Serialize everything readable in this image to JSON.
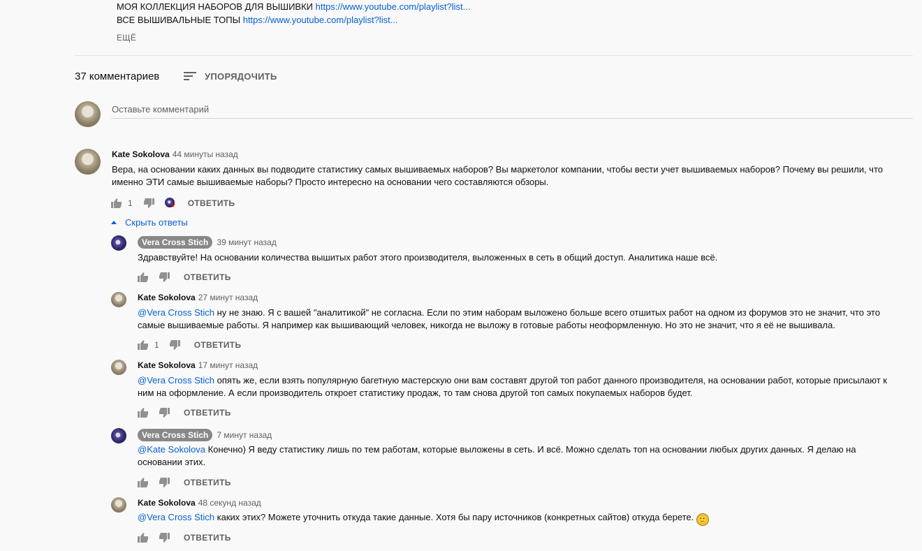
{
  "description": {
    "line1_text": "МОЯ КОЛЛЕКЦИЯ НАБОРОВ ДЛЯ ВЫШИВКИ ",
    "line1_link": "https://www.youtube.com/playlist?list...",
    "line2_text": "ВСЕ ВЫШИВАЛЬНЫЕ ТОПЫ ",
    "line2_link": "https://www.youtube.com/playlist?list...",
    "more_label": "ЕЩЁ"
  },
  "comments_header": {
    "count_label": "37 комментариев",
    "sort_label": "УПОРЯДОЧИТЬ"
  },
  "new_comment": {
    "placeholder": "Оставьте комментарий"
  },
  "top_comment": {
    "author": "Kate Sokolova",
    "time": "44 минуты назад",
    "text": "Вера, на основании каких данных вы подводите статистику самых вышиваемых наборов? Вы маркетолог компании, чтобы вести учет вышиваемых наборов? Почему вы решили, что именно ЭТИ самые вышиваемые наборы? Просто интересно на основании чего составляются обзоры.",
    "likes": "1",
    "reply_label": "ОТВЕТИТЬ",
    "hide_replies_label": "Скрыть ответы"
  },
  "replies": [
    {
      "author": "Vera Cross Stich",
      "is_channel_owner": true,
      "time": "39 минут назад",
      "mention": "",
      "text": "Здравствуйте! На основании количества вышитых работ этого производителя, выложенных в сеть в общий доступ. Аналитика наше всё.",
      "likes": "",
      "reply_label": "ОТВЕТИТЬ"
    },
    {
      "author": "Kate Sokolova",
      "is_channel_owner": false,
      "time": "27 минут назад",
      "mention": "@Vera Cross Stich",
      "text": " ну не знаю. Я с вашей \"аналитикой\" не согласна. Если по этим наборам выложено больше всего отшитых работ на одном из форумов это не значит, что это самые вышиваемые работы. Я например как вышивающий человек, никогда не выложу в готовые работы неоформленную. Но это не значит, что я её не вышивала.",
      "likes": "1",
      "reply_label": "ОТВЕТИТЬ"
    },
    {
      "author": "Kate Sokolova",
      "is_channel_owner": false,
      "time": "17 минут назад",
      "mention": "@Vera Cross Stich",
      "text": " опять же, если взять популярную багетную мастерскую они вам составят другой топ работ данного производителя, на основании работ, которые присылают к ним на оформление. А если производитель откроет статистику продаж, то там снова другой топ самых покупаемых наборов будет.",
      "likes": "",
      "reply_label": "ОТВЕТИТЬ"
    },
    {
      "author": "Vera Cross Stich",
      "is_channel_owner": true,
      "time": "7 минут назад",
      "mention": "@Kate Sokolova",
      "text": " Конечно) Я веду статистику лишь по тем работам, которые выложены в сеть. И всё. Можно сделать топ на основании любых других данных. Я делаю на основании этих.",
      "likes": "",
      "reply_label": "ОТВЕТИТЬ"
    },
    {
      "author": "Kate Sokolova",
      "is_channel_owner": false,
      "time": "48 секунд назад",
      "mention": "@Vera Cross Stich",
      "text": " каких этих? Можете уточнить откуда такие данные. Хотя бы пару источников (конкретных сайтов) откуда берете. ",
      "emoji": "🙂",
      "likes": "",
      "reply_label": "ОТВЕТИТЬ"
    }
  ],
  "icons": {
    "like": "thumb-up-icon",
    "dislike": "thumb-down-icon",
    "sort": "sort-icon",
    "hearted": "creator-heart-icon",
    "collapse": "caret-up-icon"
  },
  "colors": {
    "link": "#065fd4",
    "secondary": "#606060",
    "background": "#f9f9f9",
    "owner_badge": "#888888",
    "heart": "#e00000"
  }
}
